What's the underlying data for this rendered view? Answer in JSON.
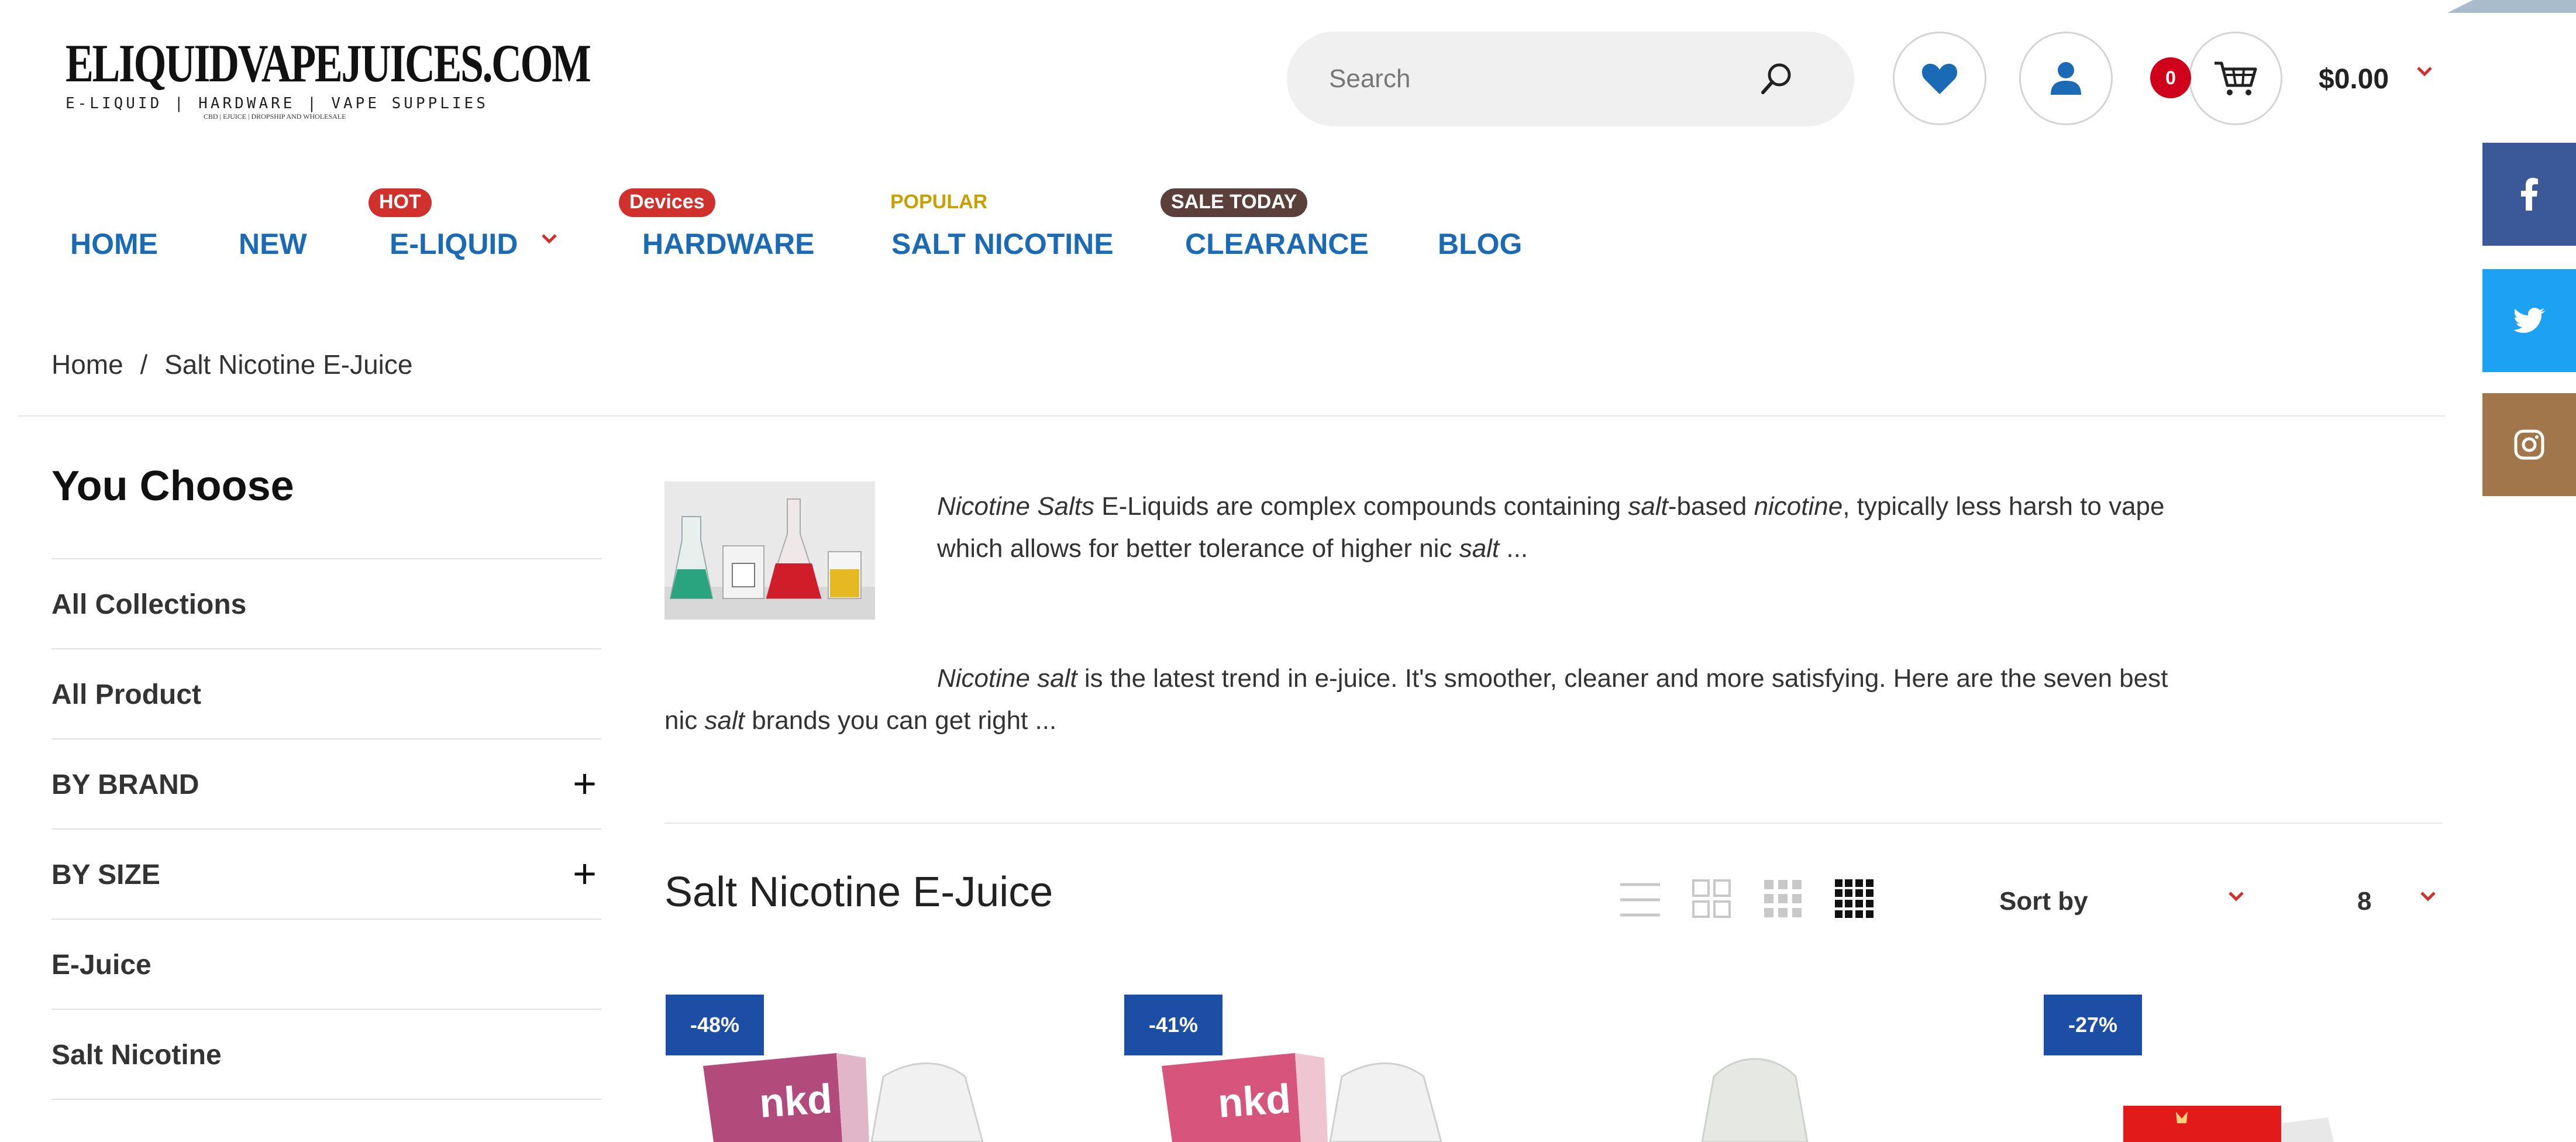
{
  "logo": {
    "main": "ELIQUIDVAPEJUICES.COM",
    "sub": "E-LIQUID | HARDWARE | VAPE SUPPLIES",
    "tiny": "CBD | EJUICE | DROPSHIP AND WHOLESALE"
  },
  "search": {
    "placeholder": "Search",
    "icon": "search-icon"
  },
  "header": {
    "wishlist_icon": "heart-icon",
    "account_icon": "user-icon",
    "cart_icon": "cart-icon",
    "cart_count": "0",
    "cart_total": "$0.00"
  },
  "nav": {
    "items": [
      {
        "label": "HOME",
        "badge": ""
      },
      {
        "label": "NEW",
        "badge": ""
      },
      {
        "label": "E-LIQUID",
        "badge": "HOT"
      },
      {
        "label": "HARDWARE",
        "badge": "Devices"
      },
      {
        "label": "SALT NICOTINE",
        "badge": "POPULAR"
      },
      {
        "label": "CLEARANCE",
        "badge": "SALE TODAY"
      },
      {
        "label": "BLOG",
        "badge": ""
      }
    ]
  },
  "breadcrumb": {
    "home": "Home",
    "sep": "/",
    "current": "Salt Nicotine E-Juice"
  },
  "sidebar": {
    "title": "You Choose",
    "items": [
      {
        "label": "All Collections",
        "expandable": false
      },
      {
        "label": "All Product",
        "expandable": false
      },
      {
        "label": "BY BRAND",
        "expandable": true
      },
      {
        "label": "BY SIZE",
        "expandable": true
      },
      {
        "label": "E-Juice",
        "expandable": false
      },
      {
        "label": "Salt Nicotine",
        "expandable": false
      }
    ],
    "expand_symbol": "+"
  },
  "content": {
    "para1": {
      "i1": "Nicotine Salts",
      "t1": " E-Liquids are complex compounds containing ",
      "i2": "salt",
      "t2": "-based ",
      "i3": "nicotine",
      "t3": ", typically less harsh to vape",
      "line2a": "which allows for better tolerance of higher nic ",
      "line2i": "salt",
      "line2b": " ..."
    },
    "para2": {
      "i1": "Nicotine salt",
      "t1": " is the latest trend in e-juice. It's smoother, cleaner and more satisfying. Here are the seven best",
      "line2a": "nic ",
      "line2i": "salt",
      "line2b": " brands you can get right ..."
    },
    "section_title": "Salt Nicotine E-Juice",
    "sort_label": "Sort by",
    "per_page": "8"
  },
  "products": [
    {
      "discount": "-48%"
    },
    {
      "discount": "-41%"
    },
    {
      "discount": ""
    },
    {
      "discount": "-27%"
    }
  ],
  "colors": {
    "nav_blue": "#1a6ab5",
    "hot_red": "#d0312d",
    "popular_gold": "#c8a000",
    "sale_brown": "#5a3f3b",
    "discount_blue": "#1c4ea6",
    "facebook": "#3b5998",
    "twitter": "#1da1f2",
    "instagram": "#a0764a"
  },
  "social": [
    "facebook-icon",
    "twitter-icon",
    "instagram-icon"
  ]
}
